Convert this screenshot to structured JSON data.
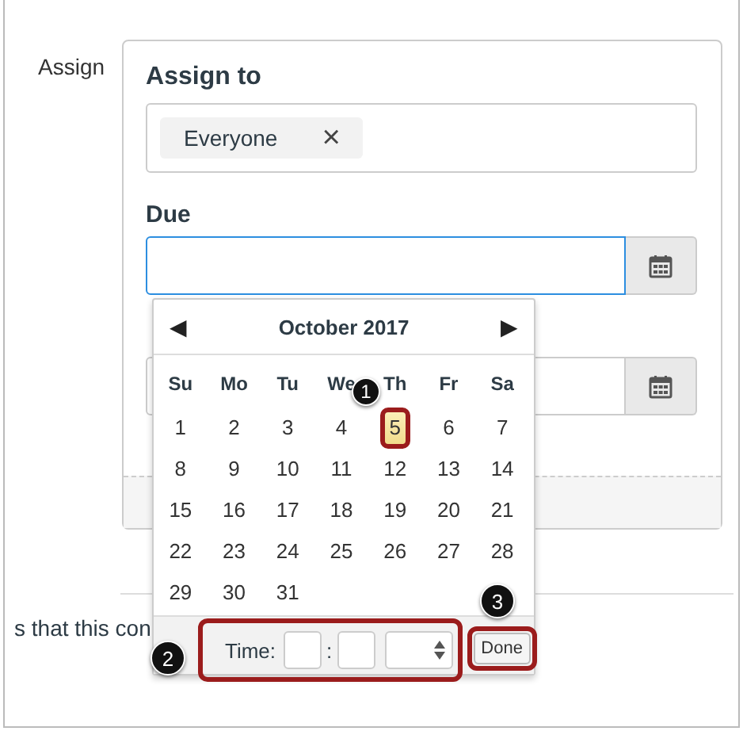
{
  "section_label": "Assign",
  "assign_to": {
    "label": "Assign to",
    "tags": [
      {
        "label": "Everyone",
        "remove": "×"
      }
    ]
  },
  "due": {
    "label": "Due"
  },
  "behind_text": "s that this con",
  "datepicker": {
    "month": "October 2017",
    "prev": "◀",
    "next": "▶",
    "weekdays": [
      "Su",
      "Mo",
      "Tu",
      "We",
      "Th",
      "Fr",
      "Sa"
    ],
    "weeks": [
      [
        {
          "label": "1",
          "selected": false
        },
        {
          "label": "2",
          "selected": false
        },
        {
          "label": "3",
          "selected": false
        },
        {
          "label": "4",
          "selected": false
        },
        {
          "label": "5",
          "selected": true
        },
        {
          "label": "6",
          "selected": false
        },
        {
          "label": "7",
          "selected": false
        }
      ],
      [
        {
          "label": "8",
          "selected": false
        },
        {
          "label": "9",
          "selected": false
        },
        {
          "label": "10",
          "selected": false
        },
        {
          "label": "11",
          "selected": false
        },
        {
          "label": "12",
          "selected": false
        },
        {
          "label": "13",
          "selected": false
        },
        {
          "label": "14",
          "selected": false
        }
      ],
      [
        {
          "label": "15",
          "selected": false
        },
        {
          "label": "16",
          "selected": false
        },
        {
          "label": "17",
          "selected": false
        },
        {
          "label": "18",
          "selected": false
        },
        {
          "label": "19",
          "selected": false
        },
        {
          "label": "20",
          "selected": false
        },
        {
          "label": "21",
          "selected": false
        }
      ],
      [
        {
          "label": "22",
          "selected": false
        },
        {
          "label": "23",
          "selected": false
        },
        {
          "label": "24",
          "selected": false
        },
        {
          "label": "25",
          "selected": false
        },
        {
          "label": "26",
          "selected": false
        },
        {
          "label": "27",
          "selected": false
        },
        {
          "label": "28",
          "selected": false
        }
      ],
      [
        {
          "label": "29",
          "selected": false
        },
        {
          "label": "30",
          "selected": false
        },
        {
          "label": "31",
          "selected": false
        }
      ]
    ],
    "time_label": "Time:",
    "time_separator": ":",
    "done": "Done"
  },
  "callouts": [
    "1",
    "2",
    "3"
  ]
}
